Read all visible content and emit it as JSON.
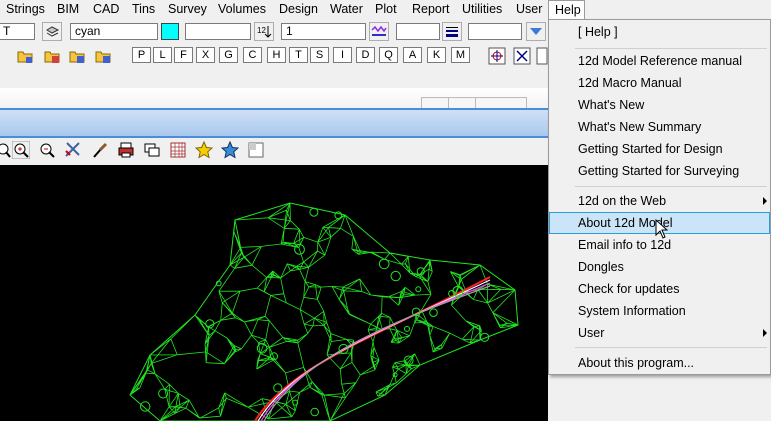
{
  "menubar": {
    "items": [
      "Strings",
      "BIM",
      "CAD",
      "Tins",
      "Survey",
      "Volumes",
      "Design",
      "Water",
      "Plot",
      "Report",
      "Utilities",
      "User",
      "Help"
    ]
  },
  "toolbar": {
    "layer_field": "T",
    "colour_name": "cyan",
    "colour_swatch": "#00ffff",
    "weight_field": "1",
    "key_buttons": [
      "P",
      "L",
      "F",
      "X",
      "G",
      "C",
      "H",
      "T",
      "S",
      "I",
      "D",
      "Q",
      "A",
      "K",
      "M"
    ]
  },
  "help_menu": {
    "items": [
      {
        "label": "[ Help ]",
        "submenu": false
      },
      {
        "label": "12d Model Reference manual",
        "submenu": false
      },
      {
        "label": "12d Macro Manual",
        "submenu": false
      },
      {
        "label": "What's New",
        "submenu": false
      },
      {
        "label": "What's New Summary",
        "submenu": false
      },
      {
        "label": "Getting Started for Design",
        "submenu": false
      },
      {
        "label": "Getting Started for Surveying",
        "submenu": false
      },
      {
        "label": "12d on the Web",
        "submenu": true
      },
      {
        "label": "About 12d Model",
        "submenu": false,
        "highlighted": true
      },
      {
        "label": "Email info to 12d",
        "submenu": false
      },
      {
        "label": "Dongles",
        "submenu": false
      },
      {
        "label": "Check for updates",
        "submenu": false
      },
      {
        "label": "System Information",
        "submenu": false
      },
      {
        "label": "User",
        "submenu": true
      },
      {
        "label": "About this program...",
        "submenu": false
      }
    ]
  },
  "colors": {
    "tin_mesh": "#22e322",
    "highlight": "#cce4f7",
    "highlight_border": "#26a0da"
  }
}
